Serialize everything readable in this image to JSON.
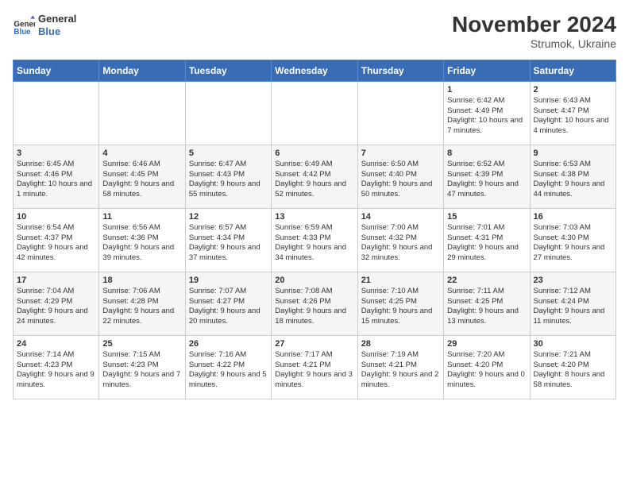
{
  "header": {
    "logo_line1": "General",
    "logo_line2": "Blue",
    "title": "November 2024",
    "subtitle": "Strumok, Ukraine"
  },
  "days_of_week": [
    "Sunday",
    "Monday",
    "Tuesday",
    "Wednesday",
    "Thursday",
    "Friday",
    "Saturday"
  ],
  "weeks": [
    [
      {
        "day": "",
        "info": ""
      },
      {
        "day": "",
        "info": ""
      },
      {
        "day": "",
        "info": ""
      },
      {
        "day": "",
        "info": ""
      },
      {
        "day": "",
        "info": ""
      },
      {
        "day": "1",
        "info": "Sunrise: 6:42 AM\nSunset: 4:49 PM\nDaylight: 10 hours and 7 minutes."
      },
      {
        "day": "2",
        "info": "Sunrise: 6:43 AM\nSunset: 4:47 PM\nDaylight: 10 hours and 4 minutes."
      }
    ],
    [
      {
        "day": "3",
        "info": "Sunrise: 6:45 AM\nSunset: 4:46 PM\nDaylight: 10 hours and 1 minute."
      },
      {
        "day": "4",
        "info": "Sunrise: 6:46 AM\nSunset: 4:45 PM\nDaylight: 9 hours and 58 minutes."
      },
      {
        "day": "5",
        "info": "Sunrise: 6:47 AM\nSunset: 4:43 PM\nDaylight: 9 hours and 55 minutes."
      },
      {
        "day": "6",
        "info": "Sunrise: 6:49 AM\nSunset: 4:42 PM\nDaylight: 9 hours and 52 minutes."
      },
      {
        "day": "7",
        "info": "Sunrise: 6:50 AM\nSunset: 4:40 PM\nDaylight: 9 hours and 50 minutes."
      },
      {
        "day": "8",
        "info": "Sunrise: 6:52 AM\nSunset: 4:39 PM\nDaylight: 9 hours and 47 minutes."
      },
      {
        "day": "9",
        "info": "Sunrise: 6:53 AM\nSunset: 4:38 PM\nDaylight: 9 hours and 44 minutes."
      }
    ],
    [
      {
        "day": "10",
        "info": "Sunrise: 6:54 AM\nSunset: 4:37 PM\nDaylight: 9 hours and 42 minutes."
      },
      {
        "day": "11",
        "info": "Sunrise: 6:56 AM\nSunset: 4:36 PM\nDaylight: 9 hours and 39 minutes."
      },
      {
        "day": "12",
        "info": "Sunrise: 6:57 AM\nSunset: 4:34 PM\nDaylight: 9 hours and 37 minutes."
      },
      {
        "day": "13",
        "info": "Sunrise: 6:59 AM\nSunset: 4:33 PM\nDaylight: 9 hours and 34 minutes."
      },
      {
        "day": "14",
        "info": "Sunrise: 7:00 AM\nSunset: 4:32 PM\nDaylight: 9 hours and 32 minutes."
      },
      {
        "day": "15",
        "info": "Sunrise: 7:01 AM\nSunset: 4:31 PM\nDaylight: 9 hours and 29 minutes."
      },
      {
        "day": "16",
        "info": "Sunrise: 7:03 AM\nSunset: 4:30 PM\nDaylight: 9 hours and 27 minutes."
      }
    ],
    [
      {
        "day": "17",
        "info": "Sunrise: 7:04 AM\nSunset: 4:29 PM\nDaylight: 9 hours and 24 minutes."
      },
      {
        "day": "18",
        "info": "Sunrise: 7:06 AM\nSunset: 4:28 PM\nDaylight: 9 hours and 22 minutes."
      },
      {
        "day": "19",
        "info": "Sunrise: 7:07 AM\nSunset: 4:27 PM\nDaylight: 9 hours and 20 minutes."
      },
      {
        "day": "20",
        "info": "Sunrise: 7:08 AM\nSunset: 4:26 PM\nDaylight: 9 hours and 18 minutes."
      },
      {
        "day": "21",
        "info": "Sunrise: 7:10 AM\nSunset: 4:25 PM\nDaylight: 9 hours and 15 minutes."
      },
      {
        "day": "22",
        "info": "Sunrise: 7:11 AM\nSunset: 4:25 PM\nDaylight: 9 hours and 13 minutes."
      },
      {
        "day": "23",
        "info": "Sunrise: 7:12 AM\nSunset: 4:24 PM\nDaylight: 9 hours and 11 minutes."
      }
    ],
    [
      {
        "day": "24",
        "info": "Sunrise: 7:14 AM\nSunset: 4:23 PM\nDaylight: 9 hours and 9 minutes."
      },
      {
        "day": "25",
        "info": "Sunrise: 7:15 AM\nSunset: 4:23 PM\nDaylight: 9 hours and 7 minutes."
      },
      {
        "day": "26",
        "info": "Sunrise: 7:16 AM\nSunset: 4:22 PM\nDaylight: 9 hours and 5 minutes."
      },
      {
        "day": "27",
        "info": "Sunrise: 7:17 AM\nSunset: 4:21 PM\nDaylight: 9 hours and 3 minutes."
      },
      {
        "day": "28",
        "info": "Sunrise: 7:19 AM\nSunset: 4:21 PM\nDaylight: 9 hours and 2 minutes."
      },
      {
        "day": "29",
        "info": "Sunrise: 7:20 AM\nSunset: 4:20 PM\nDaylight: 9 hours and 0 minutes."
      },
      {
        "day": "30",
        "info": "Sunrise: 7:21 AM\nSunset: 4:20 PM\nDaylight: 8 hours and 58 minutes."
      }
    ]
  ]
}
